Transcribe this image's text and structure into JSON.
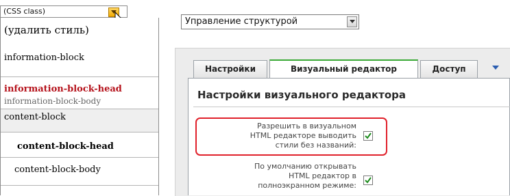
{
  "style_dropdown": {
    "header_value": "(CSS class)",
    "options": [
      {
        "label": "(удалить стиль)"
      },
      {
        "label": "information-block"
      },
      {
        "label": "information-block-head"
      },
      {
        "label": "information-block-body"
      },
      {
        "label": "content-block"
      },
      {
        "label": "content-block-head"
      },
      {
        "label": "content-block-body"
      }
    ]
  },
  "module_select": {
    "value": "Управление структурой"
  },
  "tabs": [
    {
      "label": "Настройки"
    },
    {
      "label": "Визуальный редактор",
      "active": true
    },
    {
      "label": "Доступ"
    }
  ],
  "section_title": "Настройки визуального редактора",
  "settings": [
    {
      "label_lines": [
        "Разрешить в визуальном",
        "HTML редакторе выводить",
        "стили без названий:"
      ],
      "checked": true,
      "highlighted": true
    },
    {
      "label_lines": [
        "По умолчанию открывать",
        "HTML редактор в",
        "полноэкранном режиме:"
      ],
      "checked": true,
      "highlighted": false
    }
  ],
  "colors": {
    "red_option": "#b5121b",
    "gray_option": "#666666",
    "active_tab_accent": "#3aaa35",
    "highlight_border": "#e0202a",
    "dropdown_arrow": "#f1a900"
  },
  "icons": {
    "dropdown_arrow": "chevron-down-icon",
    "cursor": "mouse-pointer-icon",
    "checkbox_check": "checkmark-icon",
    "tabs_more": "triangle-down-icon"
  }
}
